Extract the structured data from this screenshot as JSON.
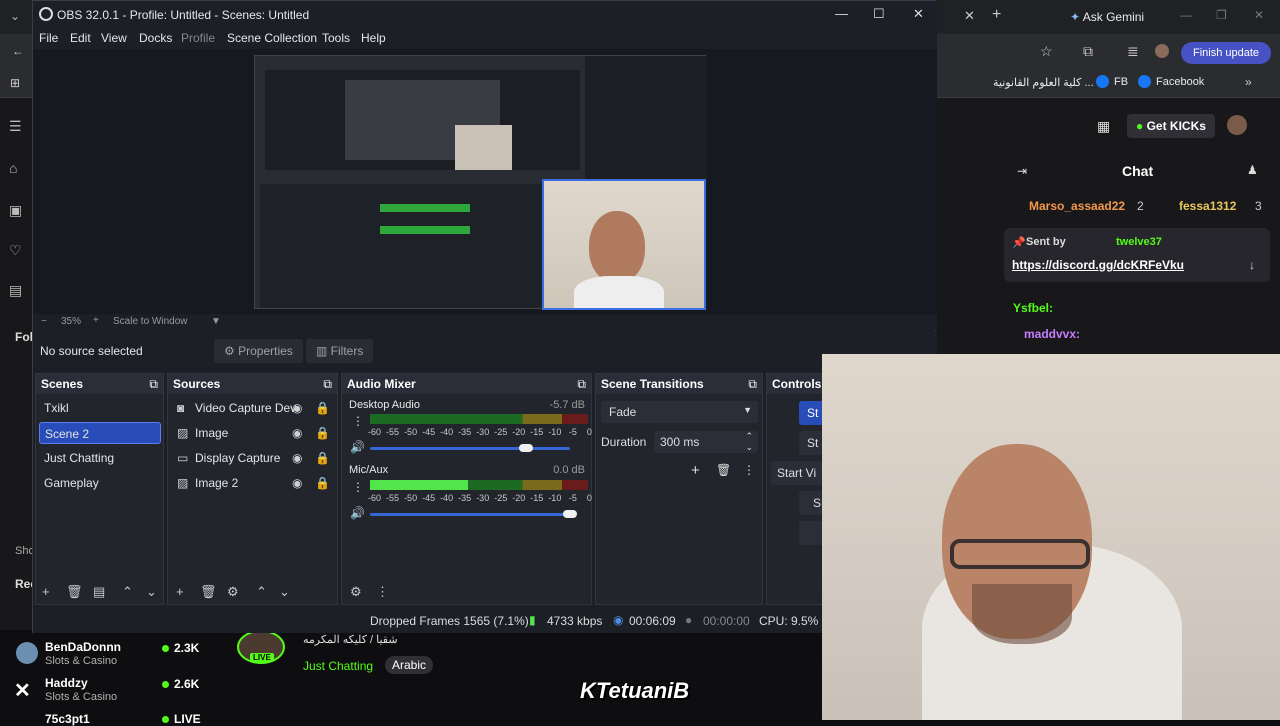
{
  "browser": {
    "ask_gemini": "Ask Gemini",
    "finish_update": "Finish update",
    "bookmarks": [
      "كلية العلوم القانونية ...",
      "FB",
      "Facebook"
    ],
    "get_kicks": "Get KICKs"
  },
  "chat": {
    "title": "Chat",
    "top_users": [
      {
        "name": "Marso_assaad22",
        "count": "2",
        "color": "#f2994a"
      },
      {
        "name": "fessa1312",
        "count": "3",
        "color": "#e8c85a"
      }
    ],
    "pinned": {
      "sent_by_label": "Sent by",
      "sender": "twelve37",
      "link": "https://discord.gg/dcKRFeVku"
    },
    "messages": [
      {
        "user": "Ysfbel:",
        "color": "#53fc18"
      },
      {
        "user": "maddvvx:",
        "color": "#c77dff"
      }
    ]
  },
  "streams": [
    {
      "name": "BenDaDonnn",
      "category": "Slots & Casino",
      "viewers": "2.3K"
    },
    {
      "name": "Haddzy",
      "category": "Slots & Casino",
      "viewers": "2.6K"
    },
    {
      "name": "75c3pt1",
      "category": "",
      "viewers": "LIVE"
    }
  ],
  "stream_info": {
    "title": "شقيا / كليكه المكرمه",
    "category": "Just Chatting",
    "tag": "Arabic",
    "live": "LIVE",
    "logo": "TetuaniB"
  },
  "left_rail": {
    "following_label": "Fol",
    "shows_label": "Sho",
    "rec_label": "Rec"
  },
  "obs": {
    "title": "OBS 32.0.1 - Profile: Untitled - Scenes: Untitled",
    "menu": [
      "File",
      "Edit",
      "View",
      "Docks",
      "Profile",
      "Scene Collection",
      "Tools",
      "Help"
    ],
    "preview": {
      "zoom": "35%",
      "scale_mode": "Scale to Window"
    },
    "no_source": "No source selected",
    "properties_label": "Properties",
    "filters_label": "Filters",
    "scenes": {
      "title": "Scenes",
      "items": [
        "Txikl",
        "Scene 2",
        "Just Chatting",
        "Gameplay"
      ],
      "selected_index": 1
    },
    "sources": {
      "title": "Sources",
      "items": [
        {
          "name": "Video Capture Dev",
          "icon": "camera-icon"
        },
        {
          "name": "Image",
          "icon": "image-icon"
        },
        {
          "name": "Display Capture",
          "icon": "monitor-icon"
        },
        {
          "name": "Image 2",
          "icon": "image-icon"
        }
      ]
    },
    "audio": {
      "title": "Audio Mixer",
      "ticks": [
        "-60",
        "-55",
        "-50",
        "-45",
        "-40",
        "-35",
        "-30",
        "-25",
        "-20",
        "-15",
        "-10",
        "-5",
        "0"
      ],
      "channels": [
        {
          "name": "Desktop Audio",
          "db": "-5.7 dB",
          "level": 0.0,
          "volume": 0.78
        },
        {
          "name": "Mic/Aux",
          "db": "0.0 dB",
          "level": 0.45,
          "volume": 1.0
        }
      ]
    },
    "transitions": {
      "title": "Scene Transitions",
      "selected": "Fade",
      "duration_label": "Duration",
      "duration_value": "300 ms"
    },
    "controls": {
      "title": "Controls",
      "buttons": [
        "St",
        "St",
        "Start Vi",
        "S"
      ]
    },
    "status": {
      "dropped": "Dropped Frames 1565 (7.1%)",
      "kbps": "4733 kbps",
      "stream_time": "00:06:09",
      "rec_time": "00:00:00",
      "cpu": "CPU: 9.5%"
    }
  }
}
